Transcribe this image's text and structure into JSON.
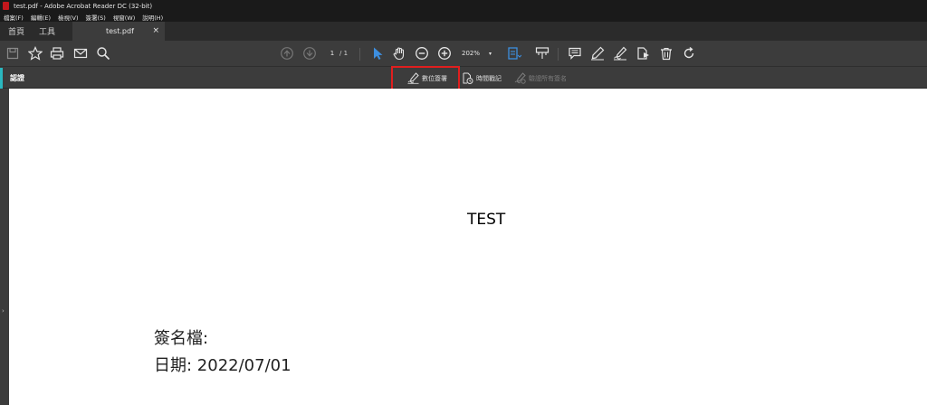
{
  "window": {
    "title": "test.pdf - Adobe Acrobat Reader DC (32-bit)"
  },
  "menu": [
    "檔案(F)",
    "編輯(E)",
    "檢視(V)",
    "簽署(S)",
    "視窗(W)",
    "說明(H)"
  ],
  "tabs": {
    "home": "首頁",
    "tools": "工具",
    "doc": "test.pdf",
    "close": "×"
  },
  "toolbar": {
    "page_current": "1",
    "page_total": "/ 1",
    "zoom": "202%",
    "zoom_arrow": "▾"
  },
  "certificates": {
    "title": "認證",
    "digital_sign": "數位簽署",
    "timestamp": "時間戳記",
    "validate_all": "驗證所有簽名"
  },
  "rail": {
    "arrow": "›"
  },
  "document": {
    "heading": "TEST",
    "signature_line": "簽名檔:",
    "date_line": "日期: 2022/07/01"
  },
  "colors": {
    "accent": "#2ab8c0",
    "highlight_box": "#e01e1e",
    "select_tool": "#3d8fe0"
  }
}
